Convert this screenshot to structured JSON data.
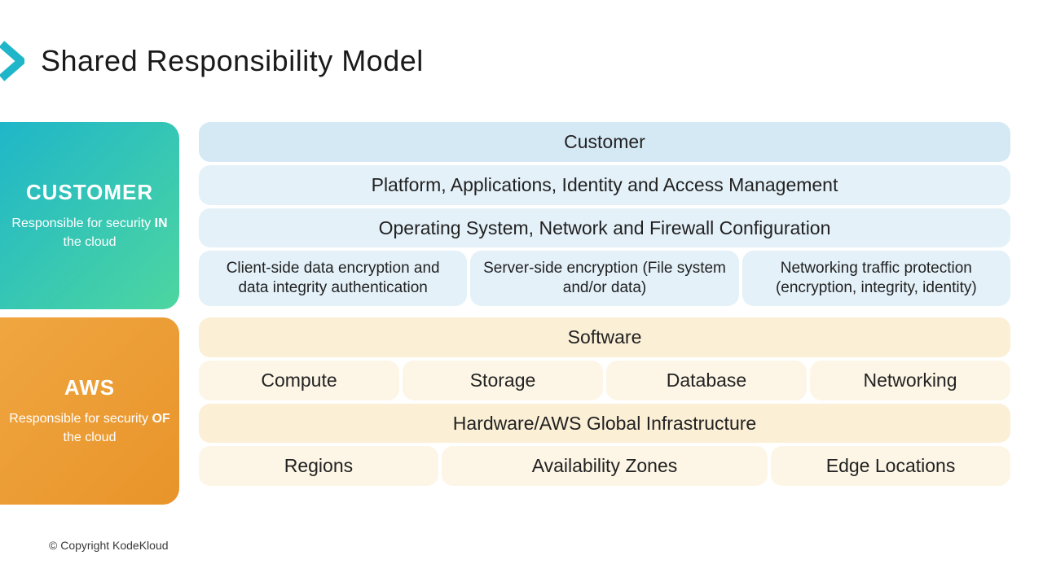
{
  "title": "Shared Responsibility Model",
  "customer": {
    "label": "CUSTOMER",
    "sub_pre": "Responsible for security ",
    "sub_bold": "IN",
    "sub_post": " the cloud",
    "rows": {
      "r1": "Customer",
      "r2": "Platform, Applications, Identity and Access Management",
      "r3": "Operating System, Network and Firewall Configuration",
      "r4": [
        "Client-side data encryption and data integrity authentication",
        "Server-side encryption (File system and/or data)",
        "Networking traffic protection (encryption, integrity, identity)"
      ]
    }
  },
  "aws": {
    "label": "AWS",
    "sub_pre": "Responsible for security ",
    "sub_bold": "OF",
    "sub_post": " the cloud",
    "rows": {
      "r1": "Software",
      "r2": [
        "Compute",
        "Storage",
        "Database",
        "Networking"
      ],
      "r3": "Hardware/AWS Global Infrastructure",
      "r4": [
        "Regions",
        "Availability Zones",
        "Edge Locations"
      ]
    }
  },
  "footer": "© Copyright KodeKloud"
}
